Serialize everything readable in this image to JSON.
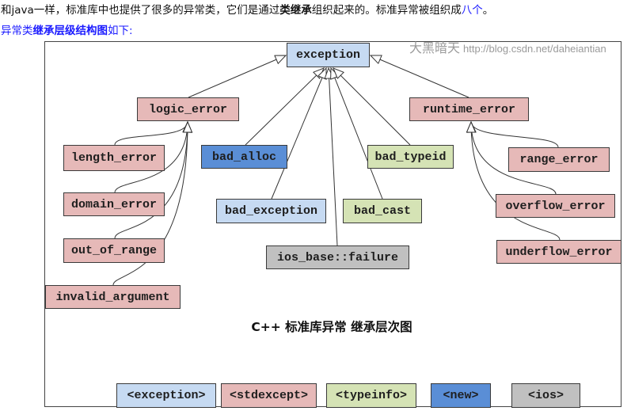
{
  "intro": {
    "line1": {
      "before": "和java一样，标准库中也提供了很多的异常类，它们是通过",
      "bold": "类继承",
      "after": "组织起来的。标准异常被组织成",
      "link": "八个",
      "end": "。"
    },
    "line2": {
      "before": "异常类",
      "bold": "继承层级结构图",
      "after": "如下:"
    }
  },
  "diagram": {
    "title": "C++ 标准库异常 继承层次图",
    "watermark": {
      "author": "大黑暗天",
      "url": "http://blog.csdn.net/daheiantian"
    },
    "nodes": [
      {
        "label": "exception",
        "header": "<exception>",
        "parent": null
      },
      {
        "label": "logic_error",
        "header": "<stdexcept>",
        "parent": "exception"
      },
      {
        "label": "runtime_error",
        "header": "<stdexcept>",
        "parent": "exception"
      },
      {
        "label": "length_error",
        "header": "<stdexcept>",
        "parent": "logic_error"
      },
      {
        "label": "domain_error",
        "header": "<stdexcept>",
        "parent": "logic_error"
      },
      {
        "label": "out_of_range",
        "header": "<stdexcept>",
        "parent": "logic_error"
      },
      {
        "label": "invalid_argument",
        "header": "<stdexcept>",
        "parent": "logic_error"
      },
      {
        "label": "bad_alloc",
        "header": "<new>",
        "parent": "exception"
      },
      {
        "label": "bad_typeid",
        "header": "<typeinfo>",
        "parent": "exception"
      },
      {
        "label": "bad_exception",
        "header": "<exception>",
        "parent": "exception"
      },
      {
        "label": "bad_cast",
        "header": "<typeinfo>",
        "parent": "exception"
      },
      {
        "label": "ios_base::failure",
        "header": "<ios>",
        "parent": "exception"
      },
      {
        "label": "range_error",
        "header": "<stdexcept>",
        "parent": "runtime_error"
      },
      {
        "label": "overflow_error",
        "header": "<stdexcept>",
        "parent": "runtime_error"
      },
      {
        "label": "underflow_error",
        "header": "<stdexcept>",
        "parent": "runtime_error"
      }
    ],
    "legend": [
      {
        "label": "<exception>",
        "color": "#c6daf2"
      },
      {
        "label": "<stdexcept>",
        "color": "#e6b9b8"
      },
      {
        "label": "<typeinfo>",
        "color": "#d5e3b5"
      },
      {
        "label": "<new>",
        "color": "#5a8ed6"
      },
      {
        "label": "<ios>",
        "color": "#c0c0c0"
      }
    ]
  }
}
